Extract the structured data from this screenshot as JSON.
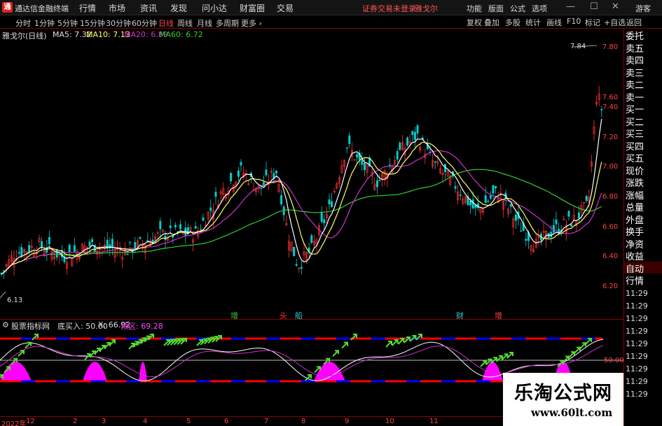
{
  "titlebar": {
    "logo": "通",
    "app_title": "通达信金融终端",
    "menus": [
      "行情",
      "市场",
      "资讯",
      "发现",
      "问小达",
      "财富圈",
      "交易"
    ],
    "notice": "证券交易未登录",
    "notice_stock": "雅戈尔",
    "right_menus": [
      "功能",
      "版面",
      "公式",
      "选项"
    ],
    "window_buttons": [
      "—",
      "☐",
      "✕"
    ],
    "guest": "游客"
  },
  "toolbar": {
    "periods": [
      "分时",
      "1分钟",
      "5分钟",
      "15分钟",
      "30分钟",
      "60分钟",
      "日线",
      "周线",
      "月线",
      "多周期",
      "更多 ›"
    ],
    "active_period": "日线",
    "buttons": [
      "复权",
      "叠加",
      "多股",
      "统计",
      "画线",
      "F10",
      "标记",
      "+自选",
      "返回"
    ]
  },
  "main_info": {
    "stock": "雅戈尔(日线)",
    "ma5": "MA5: 7.32",
    "ma10": "MA10: 7.13",
    "ma20": "MA20: 6.89",
    "ma60": "MA60: 6.72",
    "high_label": "7.84",
    "low_label": "6.13"
  },
  "price_axis": [
    "7.80",
    "7.60",
    "7.40",
    "7.20",
    "7.00",
    "6.80",
    "6.60",
    "6.40",
    "6.20"
  ],
  "signals": [
    {
      "text": "增",
      "color": "#33cc33"
    },
    {
      "text": "头",
      "color": "#ff3333"
    },
    {
      "text": "船",
      "color": "#33cccc"
    },
    {
      "text": "财",
      "color": "#33cccc"
    },
    {
      "text": "增",
      "color": "#ff4444"
    }
  ],
  "osc_info": {
    "name": "股票指标网",
    "buy": "底买入: 50.00",
    "x": "X: 66.92",
    "zone": "顶区: 69.28",
    "level": "50.00"
  },
  "right_panel": {
    "tabs": [
      "委托",
      "卖五",
      "卖四",
      "卖三",
      "卖二",
      "卖一",
      "买一",
      "买二",
      "买三",
      "买四",
      "买五",
      "现价",
      "涨跌",
      "涨幅",
      "总量",
      "外盘",
      "换手",
      "净资",
      "收益",
      "自动",
      "行情"
    ],
    "times": [
      "11:29",
      "11:29",
      "11:29",
      "11:29",
      "11:29",
      "11:29",
      "11:29",
      "11:29",
      "11:29"
    ]
  },
  "date_axis": [
    "2022年",
    "12",
    "2",
    "3",
    "4",
    "5",
    "6",
    "7",
    "8",
    "9",
    "10",
    "11"
  ],
  "watermark": {
    "title": "乐淘公式网",
    "url": "www.60lt.com"
  },
  "colors": {
    "up": "#ff3333",
    "down": "#00cccc",
    "ma5": "#ffffff",
    "ma10": "#ffff66",
    "ma20": "#cc33cc",
    "ma60": "#33cc33",
    "bull": "#ff00ff",
    "band_red": "#ff0000",
    "band_blue": "#0000ff"
  }
}
